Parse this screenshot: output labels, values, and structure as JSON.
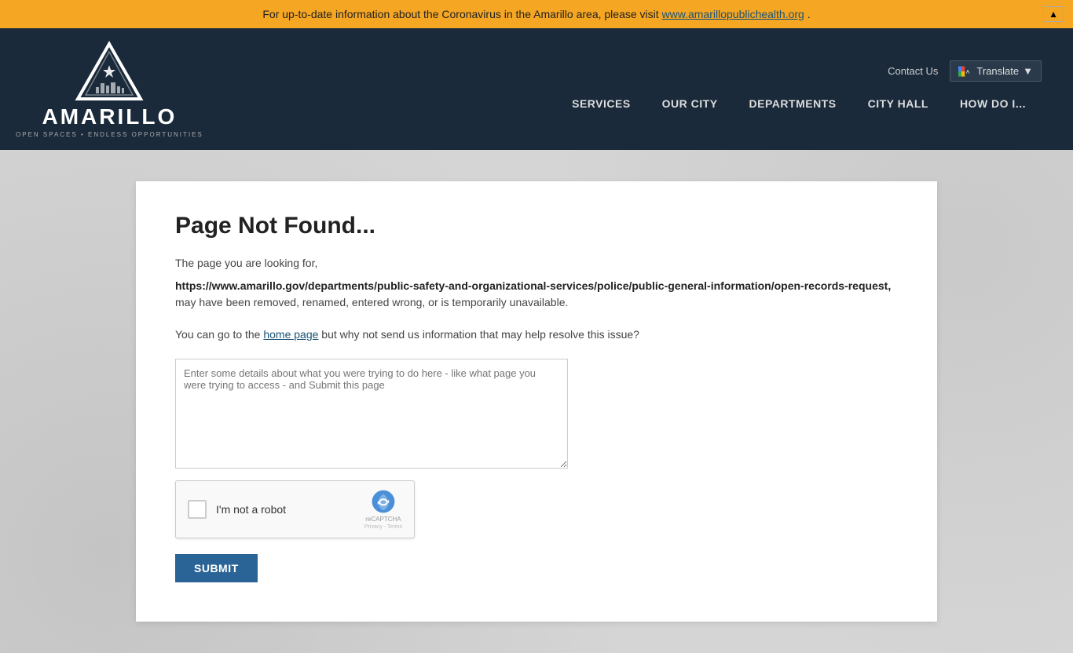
{
  "alert": {
    "text": "For up-to-date information about the Coronavirus in the Amarillo area, please visit ",
    "link_text": "www.amarillopublichealth.org",
    "link_url": "http://www.amarillopublichealth.org",
    "end_text": "."
  },
  "header": {
    "logo_alt": "City of Amarillo",
    "logo_name": "AMARILLO",
    "logo_tagline": "OPEN SPACES • ENDLESS OPPORTUNITIES",
    "contact_us": "Contact Us",
    "translate_label": "Translate",
    "nav_items": [
      "SERVICES",
      "OUR CITY",
      "DEPARTMENTS",
      "CITY HALL",
      "HOW DO I..."
    ]
  },
  "content": {
    "page_title": "Page Not Found...",
    "intro": "The page you are looking for,",
    "error_url": "https://www.amarillo.gov/departments/public-safety-and-organizational-services/police/public-general-information/open-records-request",
    "url_end": ",",
    "may_have": "may have been removed, renamed, entered wrong, or is temporarily unavailable.",
    "goto_prefix": "You can go to the ",
    "home_page_link": "home page",
    "goto_suffix": " but why not send us information that may help resolve this issue?",
    "textarea_placeholder": "Enter some details about what you were trying to do here - like what page you were trying to access - and Submit this page",
    "recaptcha_label": "I'm not a robot",
    "recaptcha_brand": "reCAPTCHA",
    "recaptcha_terms": "Privacy - Terms",
    "submit_label": "SUBMIT"
  }
}
